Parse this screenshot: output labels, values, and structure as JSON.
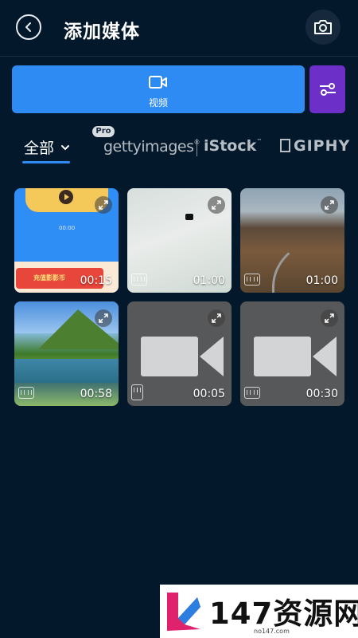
{
  "header": {
    "title": "添加媒体",
    "back_icon": "back-circle-icon",
    "camera_icon": "camera-icon"
  },
  "media_type": {
    "video_label": "视频",
    "video_icon": "video-camera-icon",
    "filter_icon": "sliders-icon"
  },
  "sources": {
    "all_label": "全部",
    "pro_badge": "Pro",
    "getty": "gettyimages",
    "istock": "iStock",
    "giphy": "GIPHY"
  },
  "grid": [
    {
      "duration": "00:15",
      "kind": "video"
    },
    {
      "duration": "01:00",
      "kind": "video"
    },
    {
      "duration": "01:00",
      "kind": "video"
    },
    {
      "duration": "00:58",
      "kind": "video"
    },
    {
      "duration": "00:05",
      "kind": "video"
    },
    {
      "duration": "00:30",
      "kind": "video"
    }
  ],
  "ad_tile": {
    "time_text": "00:00",
    "banner_text": "充值影影币"
  },
  "watermark": {
    "text": "147资源网",
    "url": "no147.com"
  },
  "colors": {
    "background": "#03182b",
    "accent_blue": "#2f8bf4",
    "accent_purple": "#6c2fc7",
    "placeholder_tile": "#57585a"
  }
}
